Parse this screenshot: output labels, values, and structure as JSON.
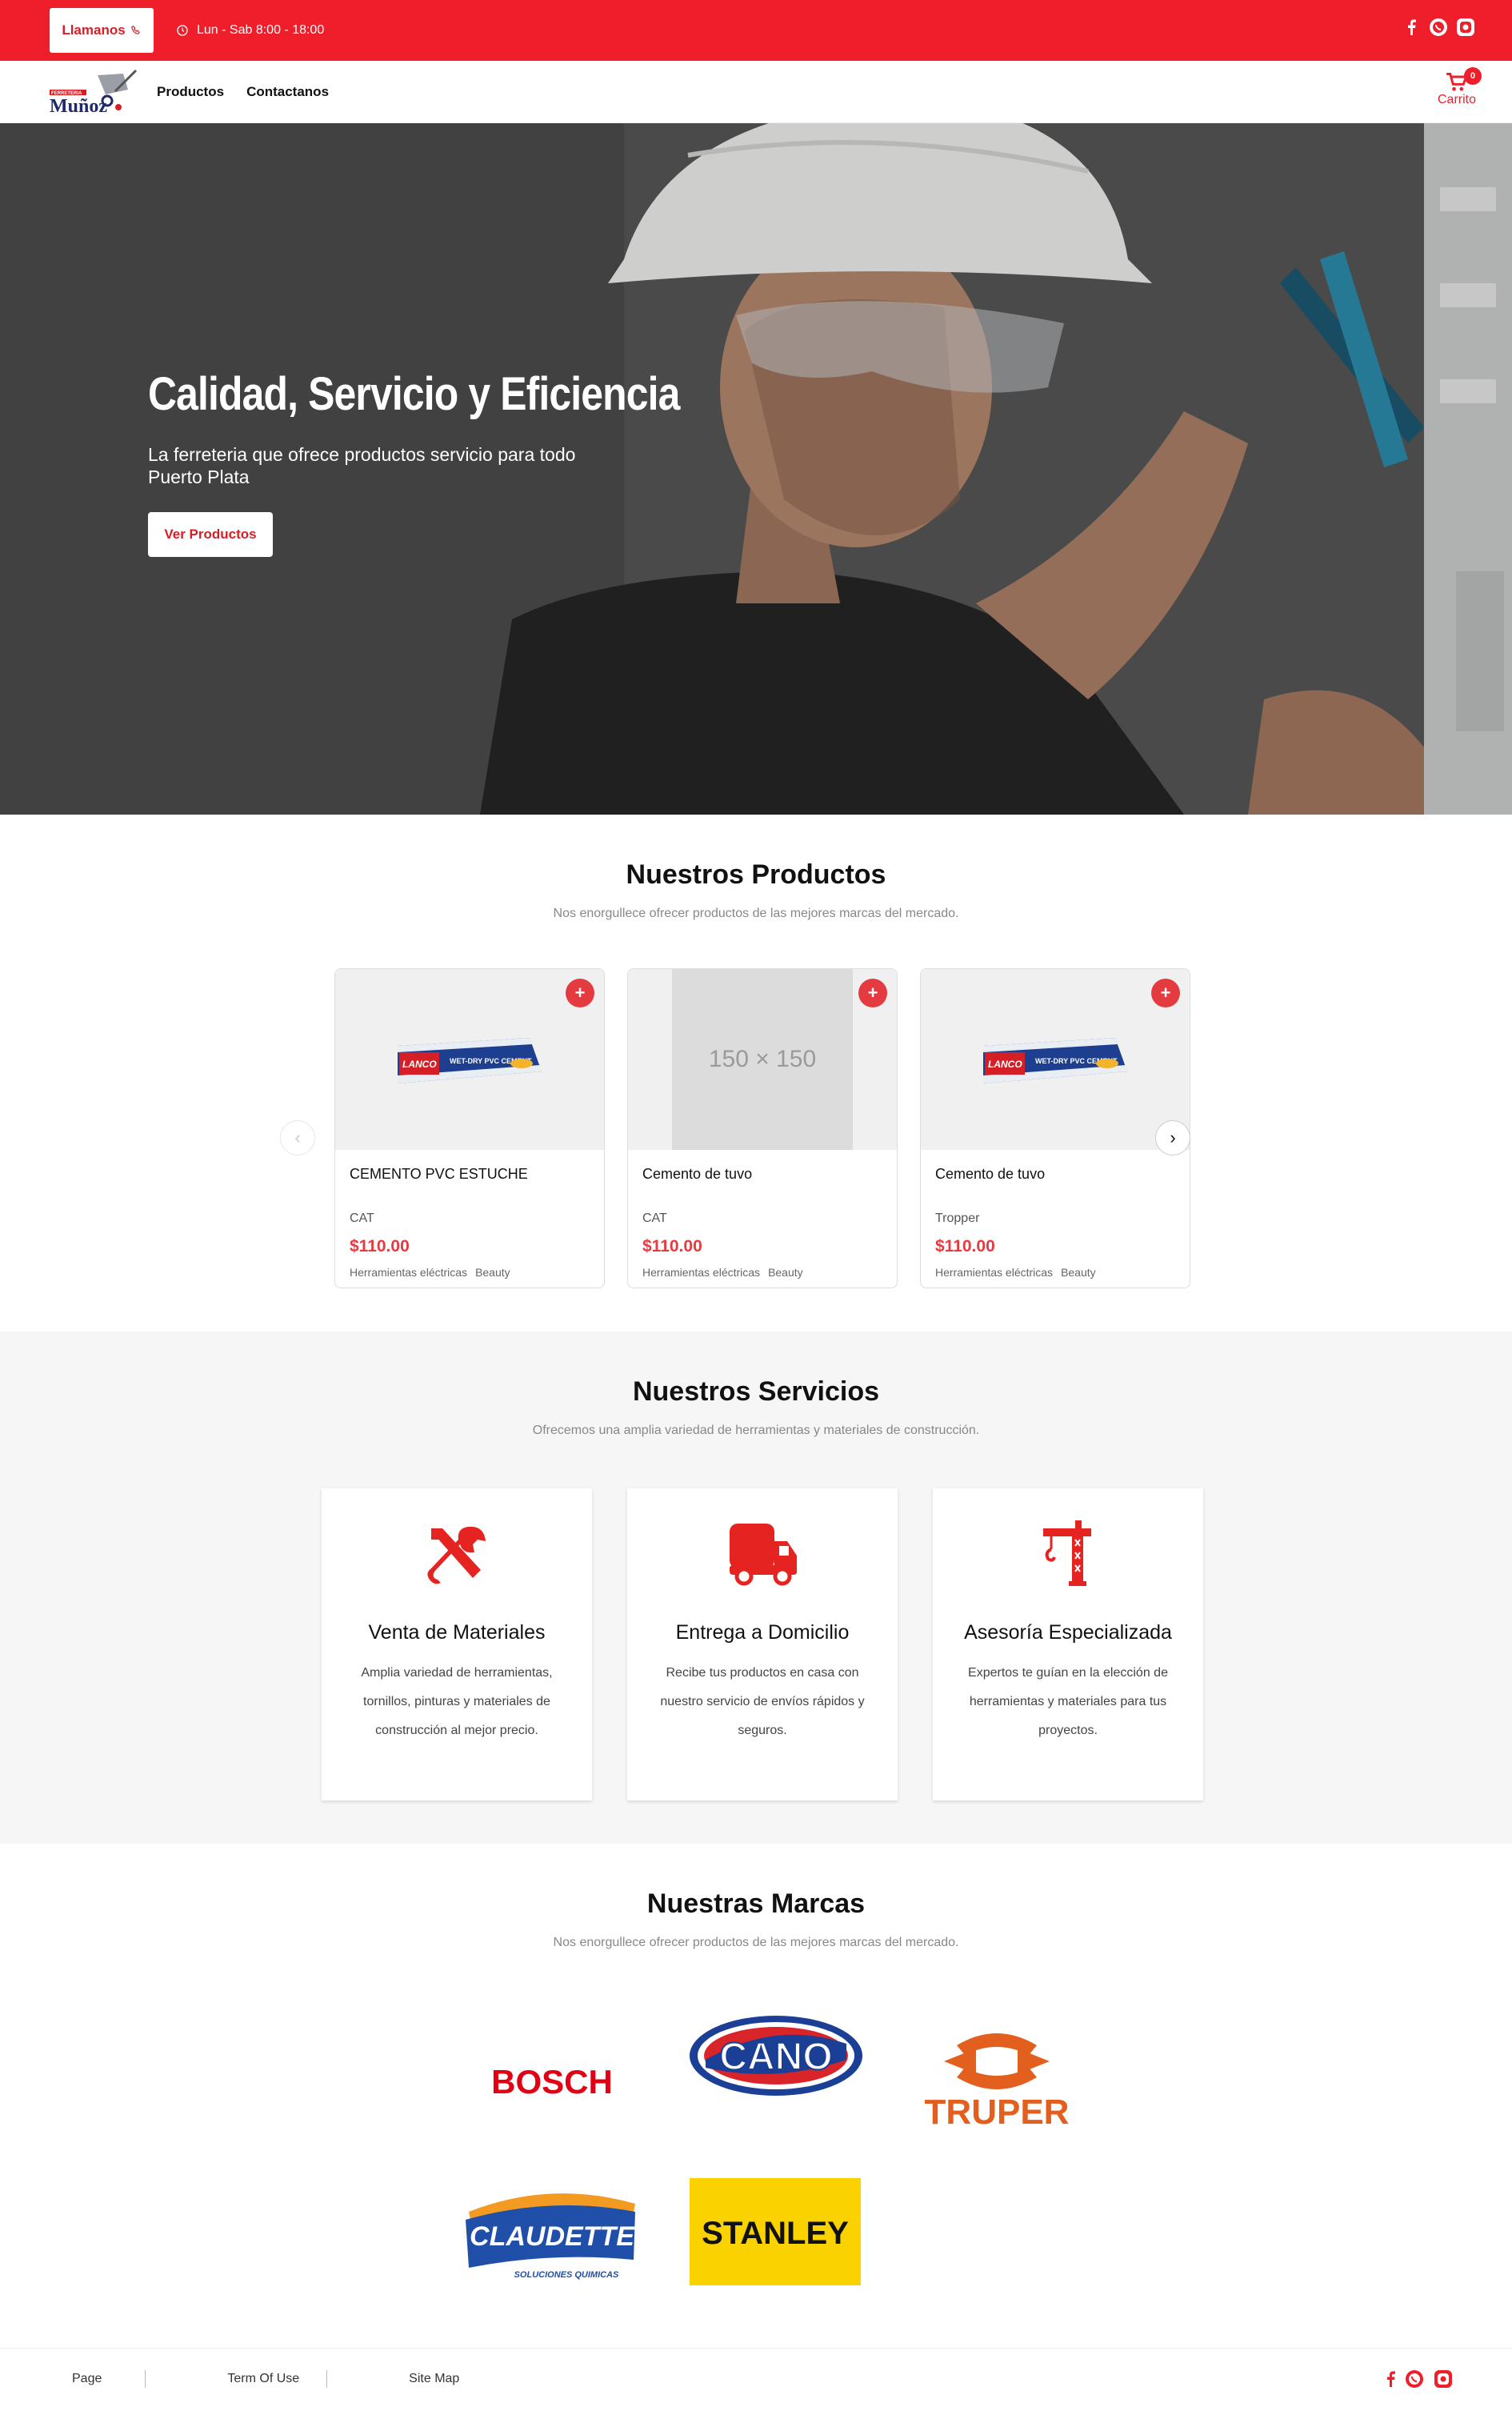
{
  "topbar": {
    "call_label": "Llamanos",
    "hours": "Lun - Sab 8:00 - 18:00",
    "social": [
      "facebook-icon",
      "whatsapp-icon",
      "instagram-icon"
    ]
  },
  "nav": {
    "logo_top": "FERRETERIA",
    "logo_main": "Muñoz",
    "links": [
      "Productos",
      "Contactanos"
    ],
    "cart_label": "Carrito",
    "cart_count": "0"
  },
  "hero": {
    "title": "Calidad, Servicio y Eficiencia",
    "subtitle": "La ferreteria que ofrece productos servicio para todo Puerto Plata",
    "button": "Ver Productos"
  },
  "products": {
    "title": "Nuestros Productos",
    "subtitle": "Nos enorgullece ofrecer productos de las mejores marcas del mercado.",
    "items": [
      {
        "name": "CEMENTO PVC ESTUCHE",
        "brand": "CAT",
        "price": "$110.00",
        "tags": [
          "Herramientas eléctricas",
          "Beauty"
        ],
        "image": "lanco-tube"
      },
      {
        "name": "Cemento de tuvo",
        "brand": "CAT",
        "price": "$110.00",
        "tags": [
          "Herramientas eléctricas",
          "Beauty"
        ],
        "image": "placeholder",
        "placeholder_text": "150 × 150"
      },
      {
        "name": "Cemento de tuvo",
        "brand": "Tropper",
        "price": "$110.00",
        "tags": [
          "Herramientas eléctricas",
          "Beauty"
        ],
        "image": "lanco-tube"
      }
    ],
    "product_label": "WET-DRY PVC CEMENT",
    "product_logo": "LANCO"
  },
  "services": {
    "title": "Nuestros Servicios",
    "subtitle": "Ofrecemos una amplia variedad de herramientas y materiales de construcción.",
    "items": [
      {
        "icon": "tools-icon",
        "title": "Venta de Materiales",
        "text": "Amplia variedad de herramientas, tornillos, pinturas y materiales de construcción al mejor precio."
      },
      {
        "icon": "truck-icon",
        "title": "Entrega a Domicilio",
        "text": "Recibe tus productos en casa con nuestro servicio de envíos rápidos y seguros."
      },
      {
        "icon": "crane-icon",
        "title": "Asesoría Especializada",
        "text": "Expertos te guían en la elección de herramientas y materiales para tus proyectos."
      }
    ]
  },
  "brands": {
    "title": "Nuestras Marcas",
    "subtitle": "Nos enorgullece ofrecer productos de las mejores marcas del mercado.",
    "items": [
      "BOSCH",
      "CANO",
      "TRUPER",
      "CLAUDETTE",
      "STANLEY"
    ],
    "claudette_tagline": "SOLUCIONES QUIMICAS"
  },
  "footer": {
    "links": [
      "Page",
      "Term Of Use",
      "Site Map"
    ]
  },
  "colors": {
    "accent": "#ee1e2a",
    "price": "#e33b3f"
  }
}
